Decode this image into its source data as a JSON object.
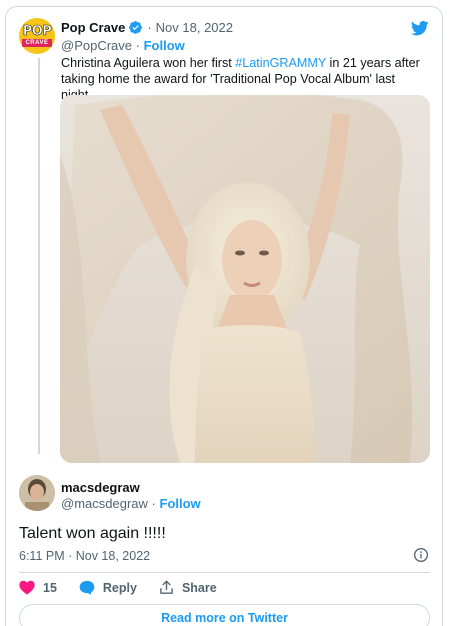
{
  "original_tweet": {
    "author_name": "Pop Crave",
    "avatar_text_top": "POP",
    "avatar_text_bottom": "CRAVE",
    "date": "Nov 18, 2022",
    "date_separator": "·",
    "handle": "@PopCrave",
    "handle_separator": "·",
    "follow_label": "Follow",
    "text_before": "Christina Aguilera won her first ",
    "hashtag": "#LatinGRAMMY",
    "text_after": " in 21 years after taking home the award for 'Traditional Pop Vocal Album' last night.",
    "verified": true
  },
  "reply": {
    "author_name": "macsdegraw",
    "handle": "@macsdegraw",
    "handle_separator": "·",
    "follow_label": "Follow",
    "text": "Talent won again !!!!!",
    "timestamp": "6:11 PM · Nov 18, 2022"
  },
  "actions": {
    "likes_count": "15",
    "reply_label": "Reply",
    "share_label": "Share"
  },
  "read_more_label": "Read more on Twitter",
  "colors": {
    "accent": "#1d9bf0",
    "like": "#f91880",
    "text_primary": "#0f1419",
    "text_secondary": "#536471",
    "border": "#cfd9de"
  },
  "icons": {
    "logo": "twitter-bird-icon",
    "verified": "verified-badge-icon",
    "info": "info-icon",
    "like": "heart-icon",
    "reply": "speech-bubble-icon",
    "share": "share-upload-icon"
  }
}
